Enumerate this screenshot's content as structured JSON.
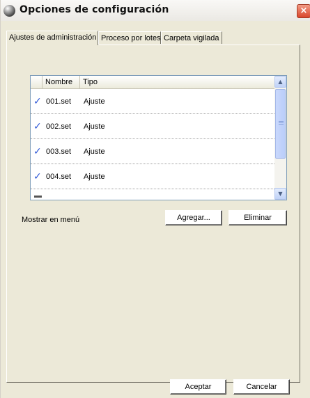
{
  "window": {
    "title": "Opciones de configuración",
    "close_glyph": "×"
  },
  "tabs": [
    {
      "label": "Ajustes de administración",
      "active": true
    },
    {
      "label": "Proceso por lotes",
      "active": false
    },
    {
      "label": "Carpeta vigilada",
      "active": false
    }
  ],
  "list": {
    "columns": [
      "Nombre",
      "Tipo"
    ],
    "rows": [
      {
        "checked": true,
        "name": "001.set",
        "type": "Ajuste"
      },
      {
        "checked": true,
        "name": "002.set",
        "type": "Ajuste"
      },
      {
        "checked": true,
        "name": "003.set",
        "type": "Ajuste"
      },
      {
        "checked": true,
        "name": "004.set",
        "type": "Ajuste"
      }
    ],
    "check_glyph": "✓"
  },
  "labels": {
    "show_in_menu": "Mostrar en menú"
  },
  "buttons": {
    "add": "Agregar...",
    "remove": "Eliminar",
    "ok": "Aceptar",
    "cancel": "Cancelar"
  },
  "scrollbar": {
    "up_glyph": "▲",
    "down_glyph": "▼"
  },
  "icons": {
    "app": "app-orb-icon",
    "close": "close-icon",
    "check": "checkmark-icon"
  },
  "colors": {
    "dialog_bg": "#ece9d8",
    "check": "#2b55d6",
    "close": "#d9462c",
    "list_border": "#7f9db9"
  }
}
